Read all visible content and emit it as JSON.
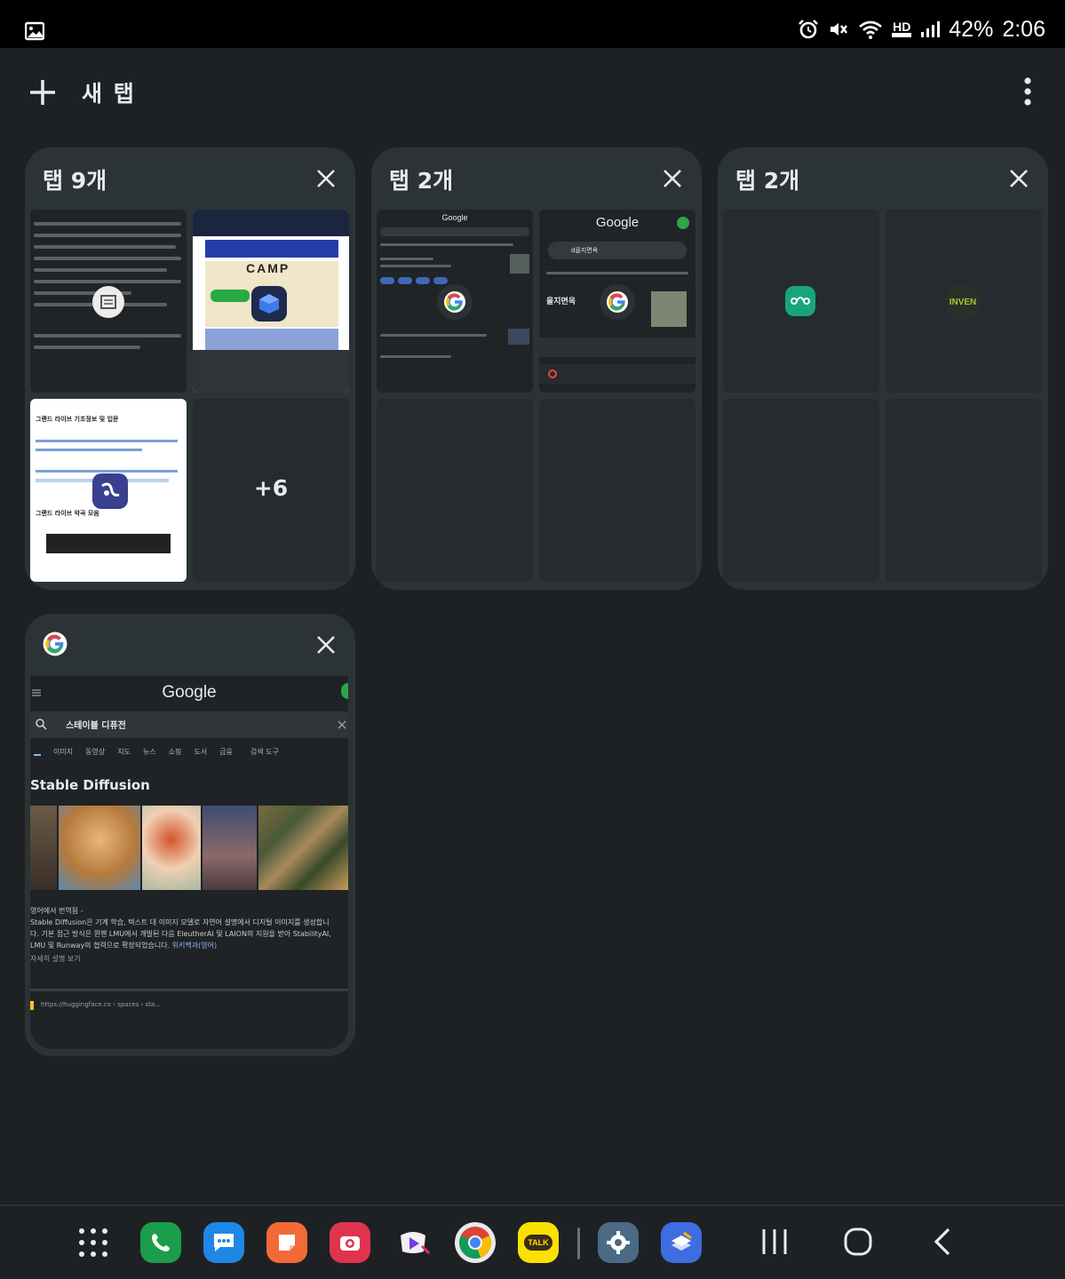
{
  "status_bar": {
    "battery_text": "42%",
    "time": "2:06",
    "network_label": "HD"
  },
  "toolbar": {
    "new_tab_label": "새 탭"
  },
  "groups": [
    {
      "title": "탭 9개",
      "more_count": "+6"
    },
    {
      "title": "탭 2개"
    },
    {
      "title": "탭 2개"
    }
  ],
  "single_tab": {
    "logo_text": "Google",
    "search_query": "스테이블 디퓨전",
    "chips": [
      "이미지",
      "동영상",
      "지도",
      "뉴스",
      "쇼핑",
      "도서",
      "금융",
      "검색 도구"
    ],
    "result_title": "Stable Diffusion",
    "desc_line1": "영어에서 번역됨 -",
    "desc_line2": "Stable Diffusion은 기계 학습, 텍스트 대 이미지 모델로 자연어 설명에서 디지털 이미지를 생성합니",
    "desc_line3": "다. 기본 접근 방식은 뮌헨 LMU에서 개발된 다음 EleutherAI 및 LAION의 지원을 받아 StabilityAI,",
    "desc_line4": "LMU 및 Runway의 협력으로 확장되었습니다.",
    "desc_link": "위키백과(영어)",
    "more_desc": "자세히 설명 보기",
    "url": "https://huggingface.co › spaces › sta..."
  },
  "thumbnails": {
    "g2_a_logo": "Google",
    "g2_b_logo": "Google",
    "g2_b_search": "d을지면옥",
    "g2_b_title": "을지면옥",
    "g3_b_label": "INVEN",
    "g1_b_camp": "CAMP",
    "g1_c_title": "그랜드 라이브 기초정보 및 입문",
    "g1_c_sub": "그랜드 라이브 악곡 모음"
  },
  "dock": {
    "kakao_label": "TALK"
  },
  "colors": {
    "background": "#1e2124",
    "group_card": "#2c3336",
    "phone_app": "#1a9e4b",
    "messages_app": "#1e88e5",
    "notes_app": "#f26a38",
    "camera_app": "#e0334f",
    "kakao_app": "#fae100",
    "settings_app": "#4a6a85"
  }
}
